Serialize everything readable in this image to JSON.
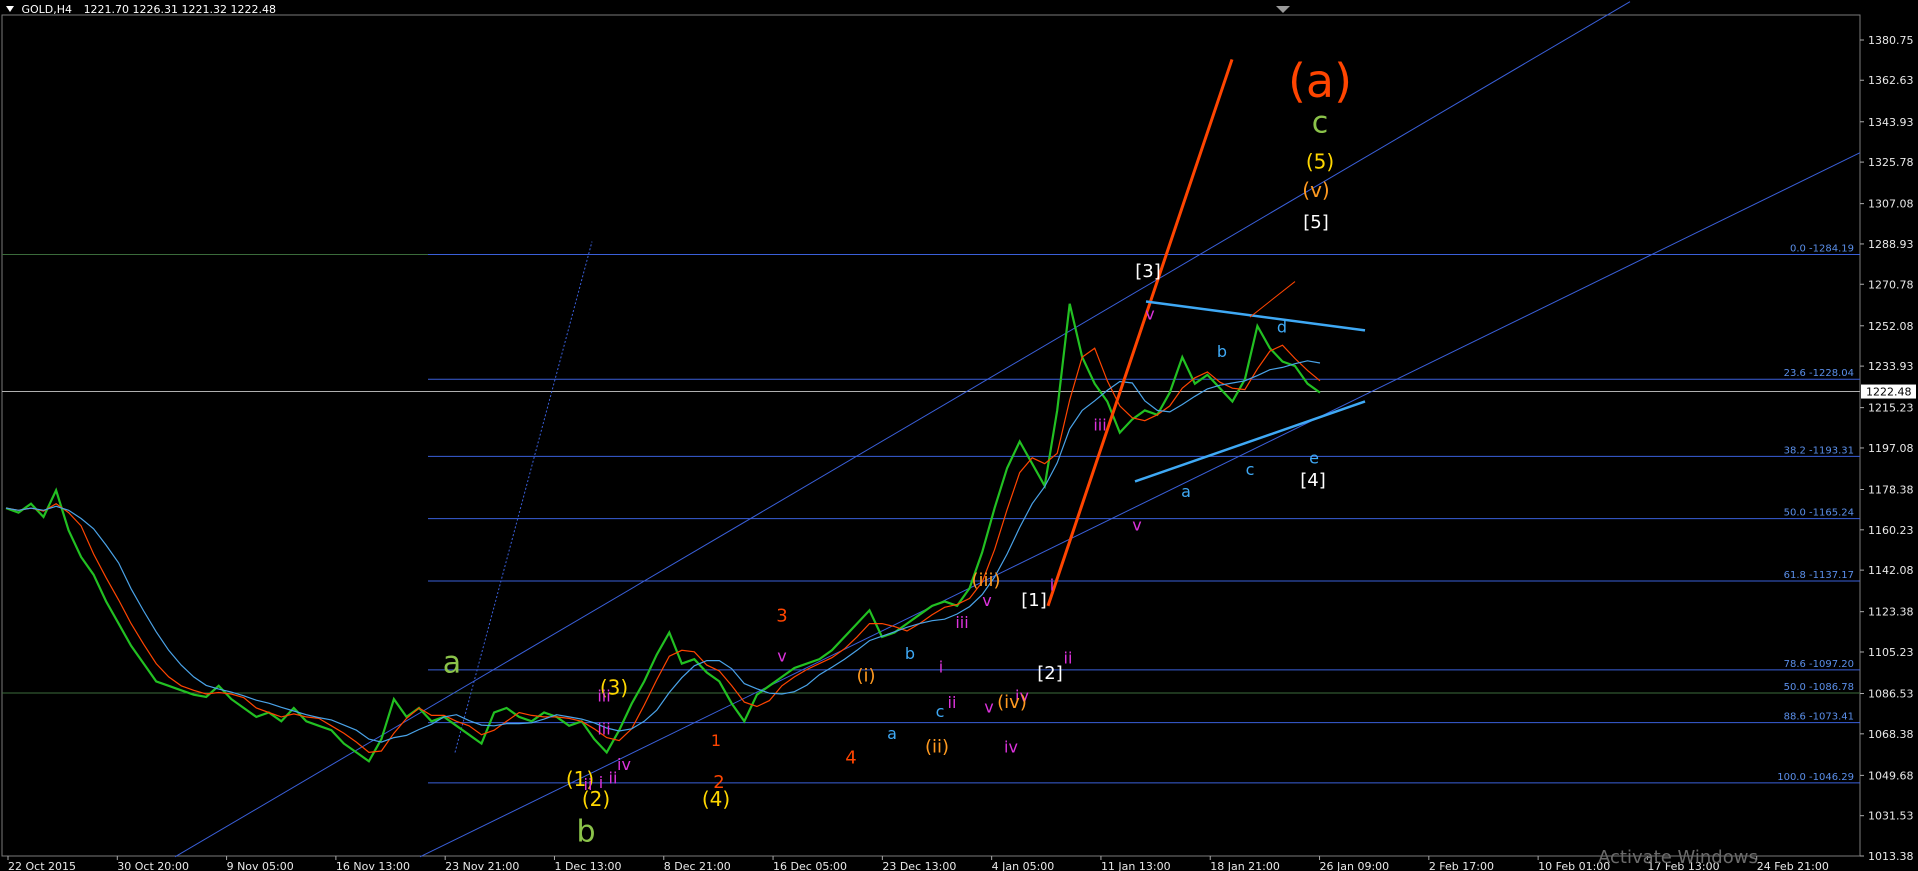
{
  "header": {
    "symbol": "GOLD,H4",
    "ohlc": "1221.70 1226.31 1221.32 1222.48"
  },
  "watermark": "Activate Windows",
  "colors": {
    "background": "#000000",
    "price_bars": "#22c022",
    "ma_fast": "#ff4500",
    "ma_slow": "#4aa3e8",
    "channel": "#3a5fd9",
    "fib_lines": "#3a5fd9",
    "fib_labels": "#5a8ee8",
    "trend_thick": "#ff4500",
    "triangle": "#3fa9f5"
  },
  "chart_data": {
    "type": "line",
    "title": "",
    "xlabel": "",
    "ylabel": "",
    "ylim": [
      1013.38,
      1392.0
    ],
    "y_ticks": [
      "1380.75",
      "1362.63",
      "1343.93",
      "1325.78",
      "1307.08",
      "1288.93",
      "1270.78",
      "1252.08",
      "1233.93",
      "1215.23",
      "1197.08",
      "1178.38",
      "1160.23",
      "1142.08",
      "1123.38",
      "1105.23",
      "1086.53",
      "1068.38",
      "1049.68",
      "1031.53",
      "1013.38"
    ],
    "current_price": "1222.48",
    "x_labels": [
      "22 Oct 2015",
      "30 Oct 20:00",
      "9 Nov 05:00",
      "16 Nov 13:00",
      "23 Nov 21:00",
      "1 Dec 13:00",
      "8 Dec 21:00",
      "16 Dec 05:00",
      "23 Dec 13:00",
      "4 Jan 05:00",
      "11 Jan 13:00",
      "18 Jan 21:00",
      "26 Jan 09:00",
      "2 Feb 17:00",
      "10 Feb 01:00",
      "17 Feb 13:00",
      "24 Feb 21:00"
    ],
    "series": [
      {
        "values": [
          1170,
          1168,
          1172,
          1166,
          1178,
          1160,
          1148,
          1140,
          1128,
          1118,
          1108,
          1100,
          1092,
          1090,
          1088,
          1086,
          1085,
          1090,
          1084,
          1080,
          1076,
          1078,
          1074,
          1080,
          1074,
          1072,
          1070,
          1064,
          1060,
          1056,
          1066,
          1084,
          1076,
          1080,
          1074,
          1076,
          1072,
          1068,
          1064,
          1078,
          1080,
          1076,
          1074,
          1078,
          1076,
          1072,
          1074,
          1066,
          1060,
          1070,
          1082,
          1092,
          1104,
          1114,
          1100,
          1102,
          1096,
          1092,
          1082,
          1074,
          1086,
          1090,
          1094,
          1098,
          1100,
          1102,
          1106,
          1112,
          1118,
          1124,
          1112,
          1114,
          1118,
          1122,
          1126,
          1128,
          1126,
          1134,
          1150,
          1170,
          1188,
          1200,
          1190,
          1180,
          1214,
          1262,
          1238,
          1226,
          1218,
          1204,
          1210,
          1214,
          1212,
          1222,
          1238,
          1226,
          1230,
          1224,
          1218,
          1228,
          1252,
          1242,
          1236,
          1234,
          1226,
          1222
        ]
      }
    ],
    "fibonacci": [
      {
        "label": "0.0 -1284.19",
        "price": 1284.19
      },
      {
        "label": "23.6 -1228.04",
        "price": 1228.04
      },
      {
        "label": "38.2 -1193.31",
        "price": 1193.31
      },
      {
        "label": "50.0 -1165.24",
        "price": 1165.24
      },
      {
        "label": "61.8 -1137.17",
        "price": 1137.17
      },
      {
        "label": "78.6 -1097.20",
        "price": 1097.2
      },
      {
        "label": "50.0 -1086.78",
        "price": 1086.78
      },
      {
        "label": "88.6 -1073.41",
        "price": 1073.41
      },
      {
        "label": "100.0 -1046.29",
        "price": 1046.29
      }
    ],
    "wave_labels": [
      {
        "text": "(a)",
        "price": 1355,
        "color": "#ff4500",
        "size": 46
      },
      {
        "text": "c",
        "price": 1339,
        "color": "#8bc34a",
        "size": 30
      },
      {
        "text": "(5)",
        "price": 1323,
        "color": "#ffd700",
        "size": 20
      },
      {
        "text": "(v)",
        "price": 1310,
        "color": "#ff9a20",
        "size": 20
      },
      {
        "text": "[5]",
        "price": 1296,
        "color": "#ffffff",
        "size": 18
      },
      {
        "text": "[3]",
        "price": 1274,
        "color": "#ffffff",
        "size": 18
      },
      {
        "text": "v",
        "price": 1255,
        "color": "#dd33dd",
        "size": 16
      },
      {
        "text": "d",
        "price": 1249,
        "color": "#3fa9f5",
        "size": 16
      },
      {
        "text": "b",
        "price": 1238,
        "color": "#3fa9f5",
        "size": 16
      },
      {
        "text": "iii",
        "price": 1205,
        "color": "#dd33dd",
        "size": 16
      },
      {
        "text": "e",
        "price": 1190,
        "color": "#3fa9f5",
        "size": 16
      },
      {
        "text": "[4]",
        "price": 1180,
        "color": "#ffffff",
        "size": 18
      },
      {
        "text": "c",
        "price": 1185,
        "color": "#3fa9f5",
        "size": 16
      },
      {
        "text": "a",
        "price": 1175,
        "color": "#3fa9f5",
        "size": 16
      },
      {
        "text": "v",
        "price": 1160,
        "color": "#dd33dd",
        "size": 16
      },
      {
        "text": "(iii)",
        "price": 1135,
        "color": "#ff9a20",
        "size": 18
      },
      {
        "text": "i",
        "price": 1133,
        "color": "#dd33dd",
        "size": 16
      },
      {
        "text": "[1]",
        "price": 1126,
        "color": "#ffffff",
        "size": 18
      },
      {
        "text": "v",
        "price": 1126,
        "color": "#dd33dd",
        "size": 16
      },
      {
        "text": "iii",
        "price": 1116,
        "color": "#dd33dd",
        "size": 16
      },
      {
        "text": "3",
        "price": 1119,
        "color": "#ff4500",
        "size": 18
      },
      {
        "text": "v",
        "price": 1101,
        "color": "#dd33dd",
        "size": 16
      },
      {
        "text": "ii",
        "price": 1100,
        "color": "#dd33dd",
        "size": 16
      },
      {
        "text": "[2]",
        "price": 1093,
        "color": "#ffffff",
        "size": 18
      },
      {
        "text": "b",
        "price": 1102,
        "color": "#3fa9f5",
        "size": 16
      },
      {
        "text": "i",
        "price": 1096,
        "color": "#dd33dd",
        "size": 16
      },
      {
        "text": "(i)",
        "price": 1092,
        "color": "#ff9a20",
        "size": 18
      },
      {
        "text": "a",
        "price": 1096,
        "color": "#8bc34a",
        "size": 30
      },
      {
        "text": "(3)",
        "price": 1086,
        "color": "#ffd700",
        "size": 20
      },
      {
        "text": "iv",
        "price": 1083,
        "color": "#dd33dd",
        "size": 16
      },
      {
        "text": "(iv)",
        "price": 1080,
        "color": "#ff9a20",
        "size": 18
      },
      {
        "text": "iii",
        "price": 1083,
        "color": "#dd33dd",
        "size": 16
      },
      {
        "text": "ii",
        "price": 1080,
        "color": "#dd33dd",
        "size": 16
      },
      {
        "text": "c",
        "price": 1076,
        "color": "#3fa9f5",
        "size": 16
      },
      {
        "text": "v",
        "price": 1078,
        "color": "#dd33dd",
        "size": 16
      },
      {
        "text": "a",
        "price": 1066,
        "color": "#3fa9f5",
        "size": 16
      },
      {
        "text": "iii",
        "price": 1068,
        "color": "#dd33dd",
        "size": 16
      },
      {
        "text": "1",
        "price": 1063,
        "color": "#ff4500",
        "size": 16
      },
      {
        "text": "iv",
        "price": 1060,
        "color": "#dd33dd",
        "size": 16
      },
      {
        "text": "(ii)",
        "price": 1060,
        "color": "#ff9a20",
        "size": 18
      },
      {
        "text": "4",
        "price": 1055,
        "color": "#ff4500",
        "size": 18
      },
      {
        "text": "iv",
        "price": 1052,
        "color": "#dd33dd",
        "size": 16
      },
      {
        "text": "ii",
        "price": 1046,
        "color": "#dd33dd",
        "size": 16
      },
      {
        "text": "(1)",
        "price": 1045,
        "color": "#ffd700",
        "size": 20
      },
      {
        "text": "i",
        "price": 1044,
        "color": "#dd33dd",
        "size": 16
      },
      {
        "text": "2",
        "price": 1044,
        "color": "#ff4500",
        "size": 18
      },
      {
        "text": "ii",
        "price": 1043,
        "color": "#dd33dd",
        "size": 16
      },
      {
        "text": "(2)",
        "price": 1036,
        "color": "#ffd700",
        "size": 20
      },
      {
        "text": "(4)",
        "price": 1036,
        "color": "#ffd700",
        "size": 20
      },
      {
        "text": "b",
        "price": 1020,
        "color": "#8bc34a",
        "size": 30
      }
    ]
  }
}
